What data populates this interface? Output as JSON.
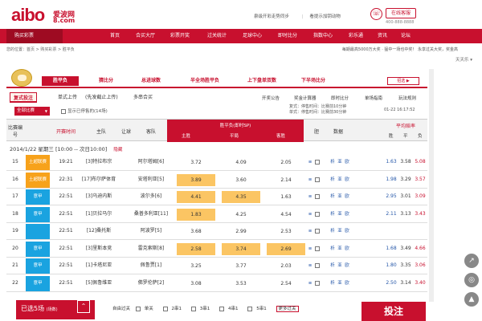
{
  "header": {
    "logo_text": "aibo",
    "logo_cn": "爱波网",
    "logo_domain": "8.com",
    "links": [
      "泉级开彩走势同步",
      "看提示加钥动物",
      "在线客服"
    ],
    "hotline": "400-888-8888"
  },
  "nav": {
    "items": [
      "购买彩票",
      "首页",
      "合买大厅",
      "彩票开奖",
      "过关统计",
      "足球中心",
      "即时比分",
      "指数中心",
      "彩乐通",
      "资讯",
      "论坛"
    ]
  },
  "subbar": {
    "left": "您的位置：首页 > 购买彩票 > 胜平负",
    "right": "每期最高5000万大奖 · 猛中一场也中奖！ 永享过关大奖，奖金高"
  },
  "tiantian": "天天乐 ▾",
  "main_tabs": [
    "胜平负",
    "猜比分",
    "总进球数",
    "半全场胜平负",
    "上下盘单双数",
    "下半场比分"
  ],
  "right_mini": "招选 ▶",
  "sub_tabs": [
    "复式投注",
    "单式上传",
    "(先发截止上传)",
    "多串合买"
  ],
  "right_links": [
    "开奖公告",
    "奖金计算器",
    "即时比分",
    "单场指南",
    "玩法规则"
  ],
  "filter": {
    "select": "全部比赛",
    "checkbox_label": "显示已停售的(14场)",
    "time1": "复式：停售时间：比赛前10分钟",
    "time2": "单式：停售时间：比赛前30分钟",
    "time3": "01-22 16:17:52"
  },
  "table": {
    "headers": {
      "match_no": "比赛编号",
      "start_time": "开赛时间",
      "home": "主队",
      "stop": "让球",
      "away": "客队",
      "sp_title": "胜平负(即时SP)",
      "sp_win": "主胜",
      "sp_draw": "平局",
      "sp_lose": "客胜",
      "bet": "胆",
      "data": "数据",
      "avg_title": "平均赔率",
      "avg_win": "胜",
      "avg_draw": "平",
      "avg_lose": "负"
    },
    "date_line": "2014/1/22 星期三 [10:00 -- 次日10:00]",
    "date_link": "隐藏",
    "rows": [
      {
        "no": "15",
        "league": "土超联赛",
        "time": "19:21",
        "home": "[3]特拉布宗",
        "handicap": "",
        "away": "阿尔塔姆[6]",
        "win": "3.72",
        "draw": "4.09",
        "lose": "2.05",
        "hl": "",
        "a_win": "1.63",
        "a_draw": "3.58",
        "a_lose": "5.08"
      },
      {
        "no": "16",
        "league": "土超联赛",
        "time": "22:31",
        "home": "[17]布尔萨体育",
        "handicap": "",
        "away": "安塔利亚[5]",
        "win": "3.89",
        "draw": "3.60",
        "lose": "2.14",
        "hl": "win",
        "a_win": "1.98",
        "a_draw": "3.29",
        "a_lose": "3.57"
      },
      {
        "no": "17",
        "league": "意甲",
        "time": "22:51",
        "home": "[3]乌迪内斯",
        "handicap": "",
        "away": "波尔多[6]",
        "win": "4.41",
        "draw": "4.35",
        "lose": "1.63",
        "hl": "wd",
        "a_win": "2.95",
        "a_draw": "3.01",
        "a_lose": "3.09"
      },
      {
        "no": "18",
        "league": "意甲",
        "time": "22:51",
        "home": "[1]贝拉马尔",
        "handicap": "",
        "away": "桑普多利亚[11]",
        "win": "1.83",
        "draw": "4.25",
        "lose": "4.54",
        "hl": "win",
        "a_win": "2.11",
        "a_draw": "3.13",
        "a_lose": "3.43"
      },
      {
        "no": "19",
        "league": "",
        "time": "22:51",
        "home": "[12]桑托斯",
        "handicap": "",
        "away": "阿波罗[5]",
        "win": "3.68",
        "draw": "2.99",
        "lose": "2.53",
        "hl": "",
        "a_win": "",
        "a_draw": "",
        "a_lose": ""
      },
      {
        "no": "20",
        "league": "意甲",
        "time": "22:51",
        "home": "[3]里斯本竞",
        "handicap": "",
        "away": "雷克索斯[8]",
        "win": "2.58",
        "draw": "3.74",
        "lose": "2.69",
        "hl": "all",
        "a_win": "1.68",
        "a_draw": "3.49",
        "a_lose": "4.66"
      },
      {
        "no": "21",
        "league": "意甲",
        "time": "22:51",
        "home": "[1]卡塔尼亚",
        "handicap": "",
        "away": "佩鲁贾[1]",
        "win": "3.25",
        "draw": "3.77",
        "lose": "2.03",
        "hl": "",
        "a_win": "1.80",
        "a_draw": "3.35",
        "a_lose": "3.06"
      },
      {
        "no": "22",
        "league": "意甲",
        "time": "22:51",
        "home": "[5]佩鲁维亚",
        "handicap": "",
        "away": "佛罗伦萨[2]",
        "win": "3.08",
        "draw": "3.53",
        "lose": "2.54",
        "hl": "",
        "a_win": "2.50",
        "a_draw": "3.14",
        "a_lose": "3.40"
      }
    ]
  },
  "footer": {
    "selected": "已选5场",
    "selected_sub": "(场数)",
    "options": [
      "自由过关",
      "单关",
      "2串1",
      "3串1",
      "4串1",
      "5串1",
      "更多过关"
    ],
    "submit": "投注"
  },
  "colors": {
    "brand": "#c8102e",
    "highlight": "#fbc563",
    "league_blue": "#1aa3e0",
    "league_orange": "#f7a21b"
  }
}
